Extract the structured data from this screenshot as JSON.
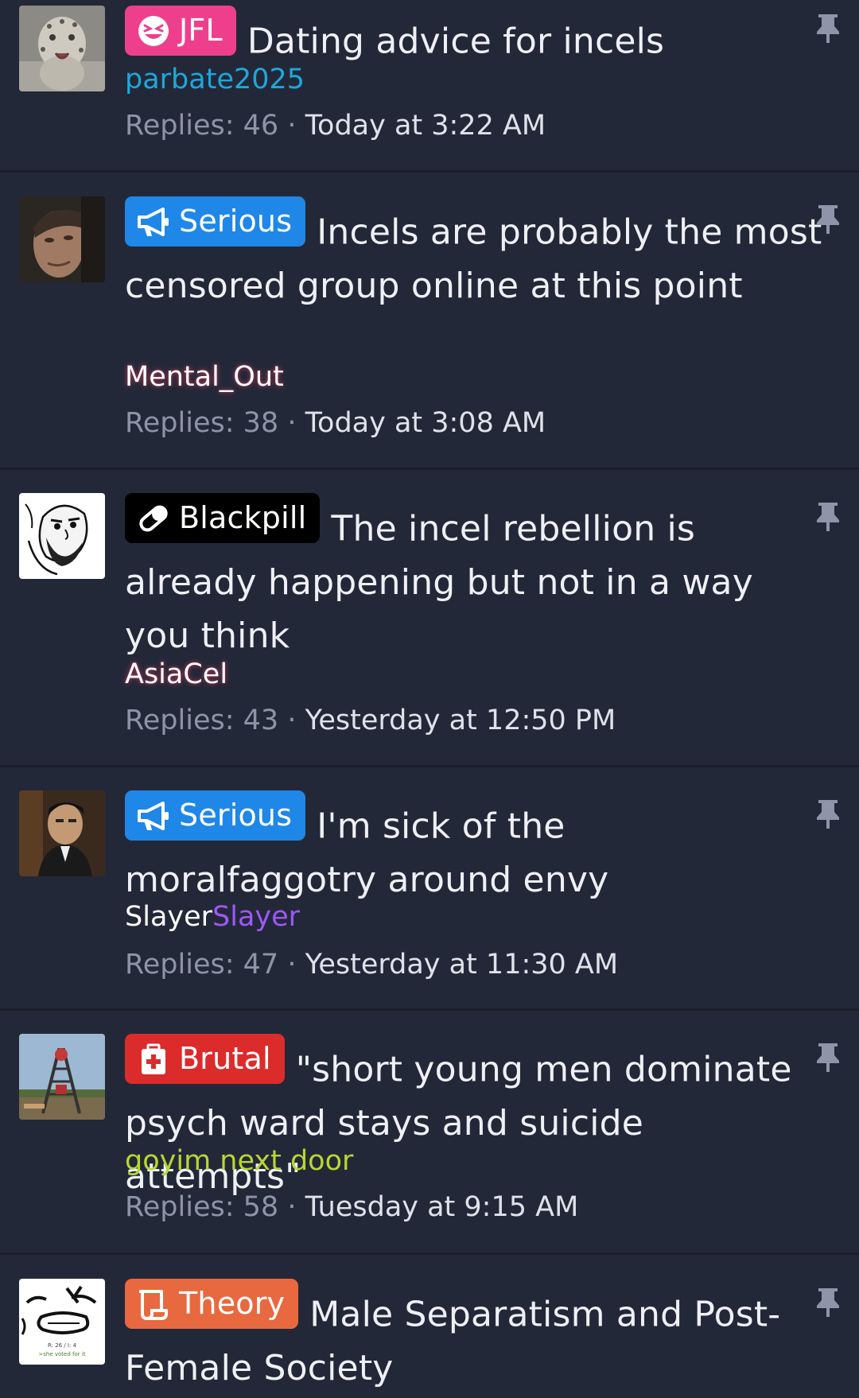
{
  "threads": [
    {
      "prefix": "JFL",
      "prefix_icon": "laughing-face-icon",
      "prefix_color": "#ee3f8d",
      "title": "Dating advice for incels",
      "author": "parbate2025",
      "author_color": "#1ea7d9",
      "replies_label": "Replies: 46",
      "separator": "·",
      "date": "Today at 3:22 AM",
      "avatar": "snow-leopard-avatar"
    },
    {
      "prefix": "Serious",
      "prefix_icon": "megaphone-icon",
      "prefix_color": "#1f87e8",
      "title": "Incels are probably the most censored group online at this point",
      "author": "Mental_Out",
      "author_color": "#ffffff",
      "replies_label": "Replies: 38",
      "separator": "·",
      "date": "Today at 3:08 AM",
      "avatar": "man-face-avatar"
    },
    {
      "prefix": "Blackpill",
      "prefix_icon": "pill-icon",
      "prefix_color": "#000000",
      "title": "The incel rebellion is already happening but not in a way you think",
      "author": "AsiaCel",
      "author_color": "#ffffff",
      "replies_label": "Replies: 43",
      "separator": "·",
      "date": "Yesterday at 12:50 PM",
      "avatar": "cartoon-sketch-avatar"
    },
    {
      "prefix": "Serious",
      "prefix_icon": "megaphone-icon",
      "prefix_color": "#1f87e8",
      "title": "I'm sick of the moralfaggotry around envy",
      "author_part1": "Slayer",
      "author_part2": "Slayer",
      "author_color1": "#ffffff",
      "author_color2": "#9b59f5",
      "replies_label": "Replies: 47",
      "separator": "·",
      "date": "Yesterday at 11:30 AM",
      "avatar": "man-in-suit-avatar"
    },
    {
      "prefix": "Brutal",
      "prefix_icon": "first-aid-icon",
      "prefix_color": "#dc2b2b",
      "title": "\"short young men dominate psych ward stays and suicide attempts\"",
      "author": "goyim next door",
      "author_color": "#b9d534",
      "replies_label": "Replies: 58",
      "separator": "·",
      "date": "Tuesday at 9:15 AM",
      "avatar": "playground-avatar"
    },
    {
      "prefix": "Theory",
      "prefix_icon": "scroll-icon",
      "prefix_color": "#e8693f",
      "title": "Male Separatism and Post-Female Society",
      "avatar": "meme-face-avatar",
      "avatar_text_line1": "R: 26 / I: 4",
      "avatar_text_line2": ">she voted for it"
    }
  ]
}
